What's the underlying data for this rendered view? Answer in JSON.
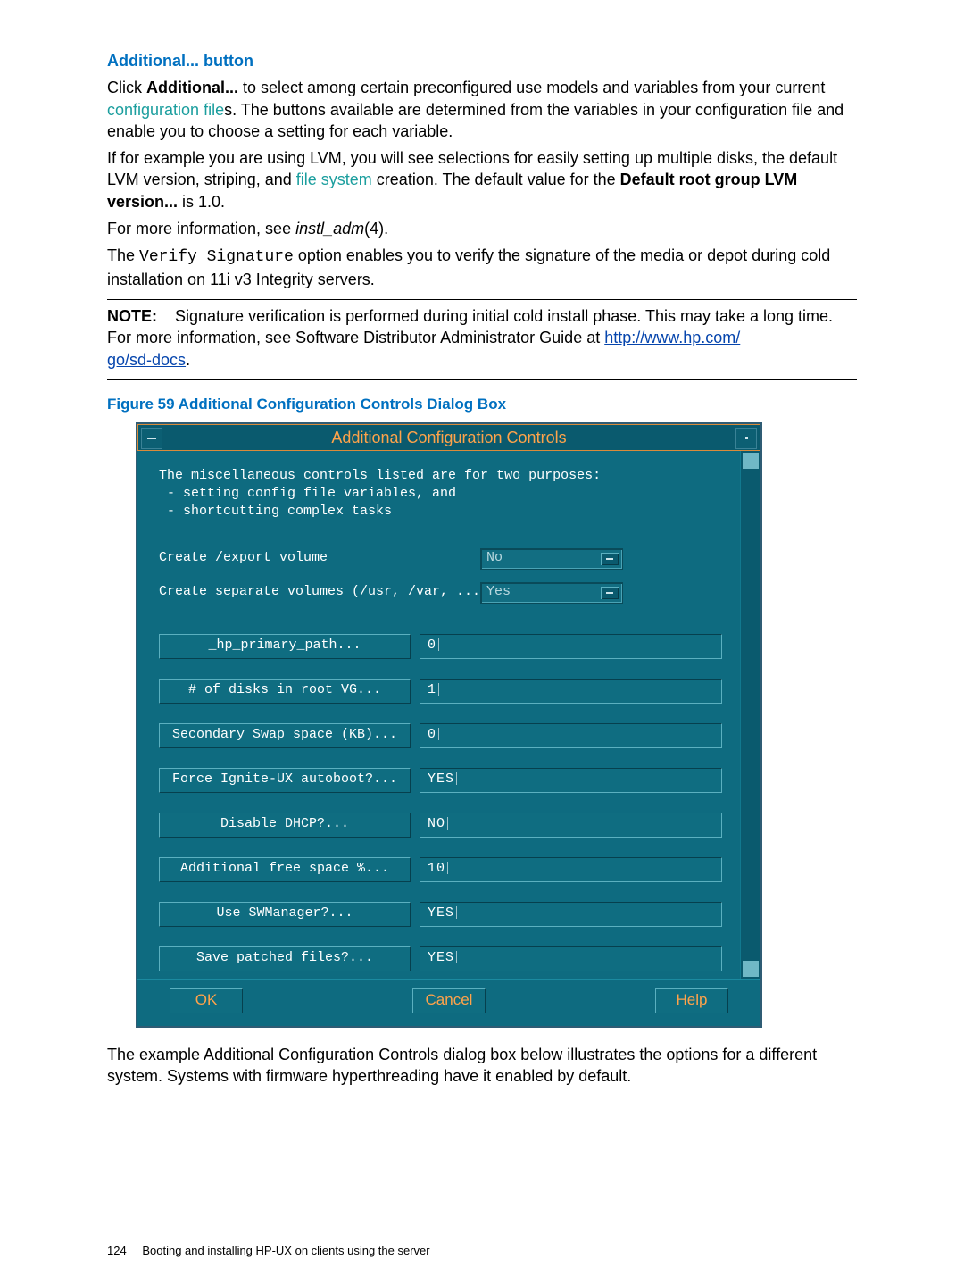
{
  "heading": "Additional... button",
  "para1_a": "Click ",
  "para1_b": "Additional...",
  "para1_c": " to select among certain preconfigured use models and variables from your current ",
  "para1_link": "configuration file",
  "para1_d": "s. The buttons available are determined from the variables in your configuration file and enable you to choose a setting for each variable.",
  "para2_a": "If for example you are using LVM, you will see selections for easily setting up multiple disks, the default LVM version, striping, and ",
  "para2_link": "file system",
  "para2_b": " creation. The default value for the ",
  "para2_bold": "Default root group LVM version...",
  "para2_c": " is 1.0.",
  "para3_a": "For more information, see ",
  "para3_i": "instl_adm",
  "para3_b": "(4).",
  "para4_a": "The ",
  "para4_mono": "Verify Signature",
  "para4_b": " option enables you to verify the signature of the media or depot during cold installation on 11i v3 Integrity servers.",
  "note_label": "NOTE:",
  "note_body_a": "Signature verification is performed during initial cold install phase. This may take a long time. For more information, see Software Distributor Administrator Guide at ",
  "note_link1": "http://www.hp.com/",
  "note_link2": "go/sd-docs",
  "note_body_b": ".",
  "figure_caption": "Figure 59 Additional Configuration Controls Dialog Box",
  "dialog": {
    "title": "Additional Configuration Controls",
    "intro1": "The miscellaneous controls listed are for two purposes:",
    "intro2": " - setting config file variables, and",
    "intro3": " - shortcutting complex tasks",
    "row1_label": "Create /export volume",
    "row1_value": "No",
    "row2_label": "Create separate volumes (/usr, /var, ...",
    "row2_value": "Yes",
    "buttons": [
      {
        "label": "_hp_primary_path...",
        "value": "0"
      },
      {
        "label": "# of disks in root VG...",
        "value": "1"
      },
      {
        "label": "Secondary Swap space (KB)...",
        "value": "0"
      },
      {
        "label": "Force Ignite-UX autoboot?...",
        "value": "YES"
      },
      {
        "label": "Disable DHCP?...",
        "value": "NO"
      },
      {
        "label": "Additional free space %...",
        "value": "10"
      },
      {
        "label": "Use SWManager?...",
        "value": "YES"
      },
      {
        "label": "Save patched files?...",
        "value": "YES"
      }
    ],
    "ok": "OK",
    "cancel": "Cancel",
    "help": "Help"
  },
  "after_text": "The example Additional Configuration Controls dialog box below illustrates the options for a different system. Systems with firmware hyperthreading have it enabled by default.",
  "footer_page": "124",
  "footer_text": "Booting and installing HP-UX on clients using the server"
}
